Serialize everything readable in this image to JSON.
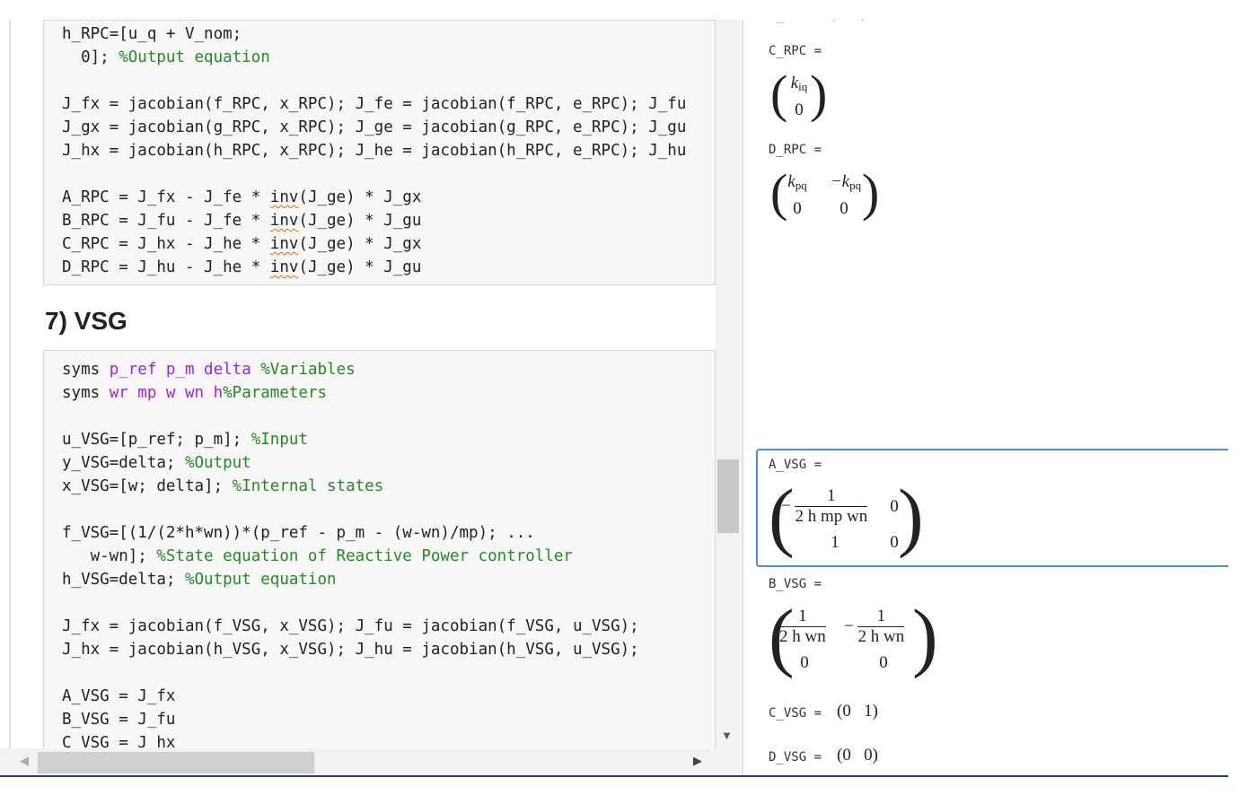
{
  "editor": {
    "block1_lines": [
      {
        "seg": [
          {
            "t": "h_RPC=[u_q + V_nom;",
            "c": "kw"
          }
        ]
      },
      {
        "seg": [
          {
            "t": "  0]; ",
            "c": "kw"
          },
          {
            "t": "%Output equation",
            "c": "cm"
          }
        ]
      },
      {
        "seg": []
      },
      {
        "seg": [
          {
            "t": "J_fx = jacobian(f_RPC, x_RPC); J_fe = jacobian(f_RPC, e_RPC); J_fu",
            "c": "kw"
          }
        ]
      },
      {
        "seg": [
          {
            "t": "J_gx = jacobian(g_RPC, x_RPC); J_ge = jacobian(g_RPC, e_RPC); J_gu",
            "c": "kw"
          }
        ]
      },
      {
        "seg": [
          {
            "t": "J_hx = jacobian(h_RPC, x_RPC); J_he = jacobian(h_RPC, e_RPC); J_hu",
            "c": "kw"
          }
        ]
      },
      {
        "seg": []
      },
      {
        "seg": [
          {
            "t": "A_RPC = J_fx - J_fe * ",
            "c": "kw"
          },
          {
            "t": "inv",
            "c": "squig"
          },
          {
            "t": "(J_ge) * J_gx",
            "c": "kw"
          }
        ]
      },
      {
        "seg": [
          {
            "t": "B_RPC = J_fu - J_fe * ",
            "c": "kw"
          },
          {
            "t": "inv",
            "c": "squig"
          },
          {
            "t": "(J_ge) * J_gu",
            "c": "kw"
          }
        ]
      },
      {
        "seg": [
          {
            "t": "C_RPC = J_hx - J_he * ",
            "c": "kw"
          },
          {
            "t": "inv",
            "c": "squig"
          },
          {
            "t": "(J_ge) * J_gx",
            "c": "kw"
          }
        ]
      },
      {
        "seg": [
          {
            "t": "D_RPC = J_hu - J_he * ",
            "c": "kw"
          },
          {
            "t": "inv",
            "c": "squig"
          },
          {
            "t": "(J_ge) * J_gu",
            "c": "kw"
          }
        ]
      }
    ],
    "section_title": "7) VSG",
    "block2_lines": [
      {
        "seg": [
          {
            "t": "syms ",
            "c": "kw"
          },
          {
            "t": "p_ref p_m delta ",
            "c": "var"
          },
          {
            "t": "%Variables",
            "c": "cm"
          }
        ]
      },
      {
        "seg": [
          {
            "t": "syms ",
            "c": "kw"
          },
          {
            "t": "wr mp w wn h",
            "c": "var"
          },
          {
            "t": "%Parameters",
            "c": "cm"
          }
        ]
      },
      {
        "seg": []
      },
      {
        "seg": [
          {
            "t": "u_VSG=[p_ref; p_m]; ",
            "c": "kw"
          },
          {
            "t": "%Input",
            "c": "cm"
          }
        ]
      },
      {
        "seg": [
          {
            "t": "y_VSG=delta; ",
            "c": "kw"
          },
          {
            "t": "%Output",
            "c": "cm"
          }
        ]
      },
      {
        "seg": [
          {
            "t": "x_VSG=[w; delta]; ",
            "c": "kw"
          },
          {
            "t": "%Internal states",
            "c": "cm"
          }
        ]
      },
      {
        "seg": []
      },
      {
        "seg": [
          {
            "t": "f_VSG=[(1/(2*h*wn))*(p_ref - p_m - (w-wn)/mp); ",
            "c": "kw"
          },
          {
            "t": "...",
            "c": "ellip"
          }
        ]
      },
      {
        "seg": [
          {
            "t": "   w-wn]; ",
            "c": "kw"
          },
          {
            "t": "%State equation of Reactive Power controller",
            "c": "cm"
          }
        ]
      },
      {
        "seg": [
          {
            "t": "h_VSG=delta; ",
            "c": "kw"
          },
          {
            "t": "%Output equation",
            "c": "cm"
          }
        ]
      },
      {
        "seg": []
      },
      {
        "seg": [
          {
            "t": "J_fx = jacobian(f_VSG, x_VSG); J_fu = jacobian(f_VSG, u_VSG);",
            "c": "kw"
          }
        ]
      },
      {
        "seg": [
          {
            "t": "J_hx = jacobian(h_VSG, x_VSG); J_hu = jacobian(h_VSG, u_VSG);",
            "c": "kw"
          }
        ]
      },
      {
        "seg": []
      },
      {
        "seg": [
          {
            "t": "A_VSG = J_fx",
            "c": "kw"
          }
        ]
      },
      {
        "seg": [
          {
            "t": "B_VSG = J_fu",
            "c": "kw"
          }
        ]
      },
      {
        "seg": [
          {
            "t": "C_VSG = J_hx",
            "c": "kw"
          }
        ]
      }
    ]
  },
  "output": {
    "c_rpc_label": "C_RPC =",
    "c_rpc": {
      "r1": "k",
      "r1sub": "iq",
      "r2": "0"
    },
    "d_rpc_label": "D_RPC =",
    "d_rpc": {
      "a": "k",
      "asub": "pq",
      "b": "−k",
      "bsub": "pq",
      "c": "0",
      "d": "0"
    },
    "a_vsg_label": "A_VSG =",
    "a_vsg": {
      "neg": "−",
      "num": "1",
      "den": "2 h mp wn",
      "b": "0",
      "c": "1",
      "d": "0"
    },
    "b_vsg_label": "B_VSG =",
    "b_vsg": {
      "num1": "1",
      "den1": "2 h wn",
      "neg": "−",
      "num2": "1",
      "den2": "2 h wn",
      "c": "0",
      "d": "0"
    },
    "c_vsg_label": "C_VSG =",
    "c_vsg": "(0   1)",
    "d_vsg_label": "D_VSG =",
    "d_vsg": "(0   0)"
  },
  "colors": {
    "comment": "#228b22",
    "variable": "#a020f0",
    "ellipsis": "#0000ff",
    "focus_border": "#4a90d9"
  }
}
